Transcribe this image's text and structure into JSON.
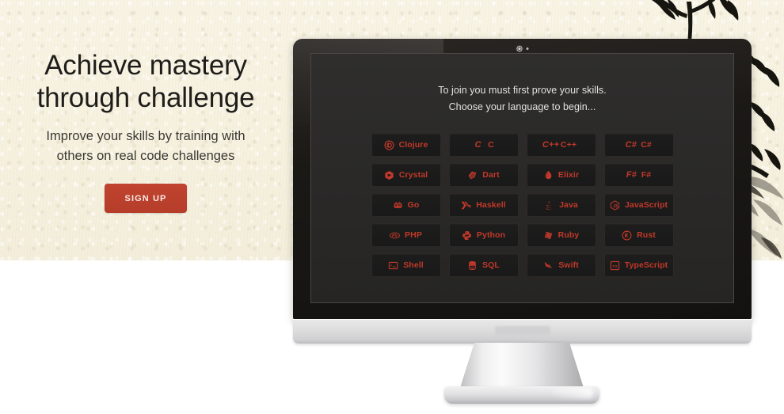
{
  "hero": {
    "title_line1": "Achieve mastery",
    "title_line2": "through challenge",
    "subtitle_line1": "Improve your skills by training with",
    "subtitle_line2": "others on real code challenges",
    "signup_label": "SIGN UP"
  },
  "screen": {
    "prompt_line1": "To join you must first prove your skills.",
    "prompt_line2": "Choose your language to begin...",
    "languages": [
      {
        "label": "Clojure",
        "icon": "clojure-icon"
      },
      {
        "label": "C",
        "icon": "c-icon",
        "glyph": "C"
      },
      {
        "label": "C++",
        "icon": "cpp-icon",
        "glyph": "C++"
      },
      {
        "label": "C#",
        "icon": "csharp-icon",
        "glyph": "C#"
      },
      {
        "label": "Crystal",
        "icon": "crystal-icon"
      },
      {
        "label": "Dart",
        "icon": "dart-icon"
      },
      {
        "label": "Elixir",
        "icon": "elixir-icon"
      },
      {
        "label": "F#",
        "icon": "fsharp-icon",
        "glyph": "F#"
      },
      {
        "label": "Go",
        "icon": "go-gopher-icon"
      },
      {
        "label": "Haskell",
        "icon": "haskell-icon"
      },
      {
        "label": "Java",
        "icon": "java-icon"
      },
      {
        "label": "JavaScript",
        "icon": "javascript-icon"
      },
      {
        "label": "PHP",
        "icon": "php-icon"
      },
      {
        "label": "Python",
        "icon": "python-icon"
      },
      {
        "label": "Ruby",
        "icon": "ruby-icon"
      },
      {
        "label": "Rust",
        "icon": "rust-icon"
      },
      {
        "label": "Shell",
        "icon": "shell-terminal-icon"
      },
      {
        "label": "SQL",
        "icon": "sql-database-icon"
      },
      {
        "label": "Swift",
        "icon": "swift-bird-icon"
      },
      {
        "label": "TypeScript",
        "icon": "typescript-icon"
      }
    ]
  },
  "colors": {
    "accent_red": "#c1392a",
    "signup_red": "#b9402f",
    "paper_cream": "#f6f1de",
    "screen_dark": "#2b2a29",
    "tile_dark": "#1c1b1b",
    "text_dark": "#1f1d1a"
  }
}
